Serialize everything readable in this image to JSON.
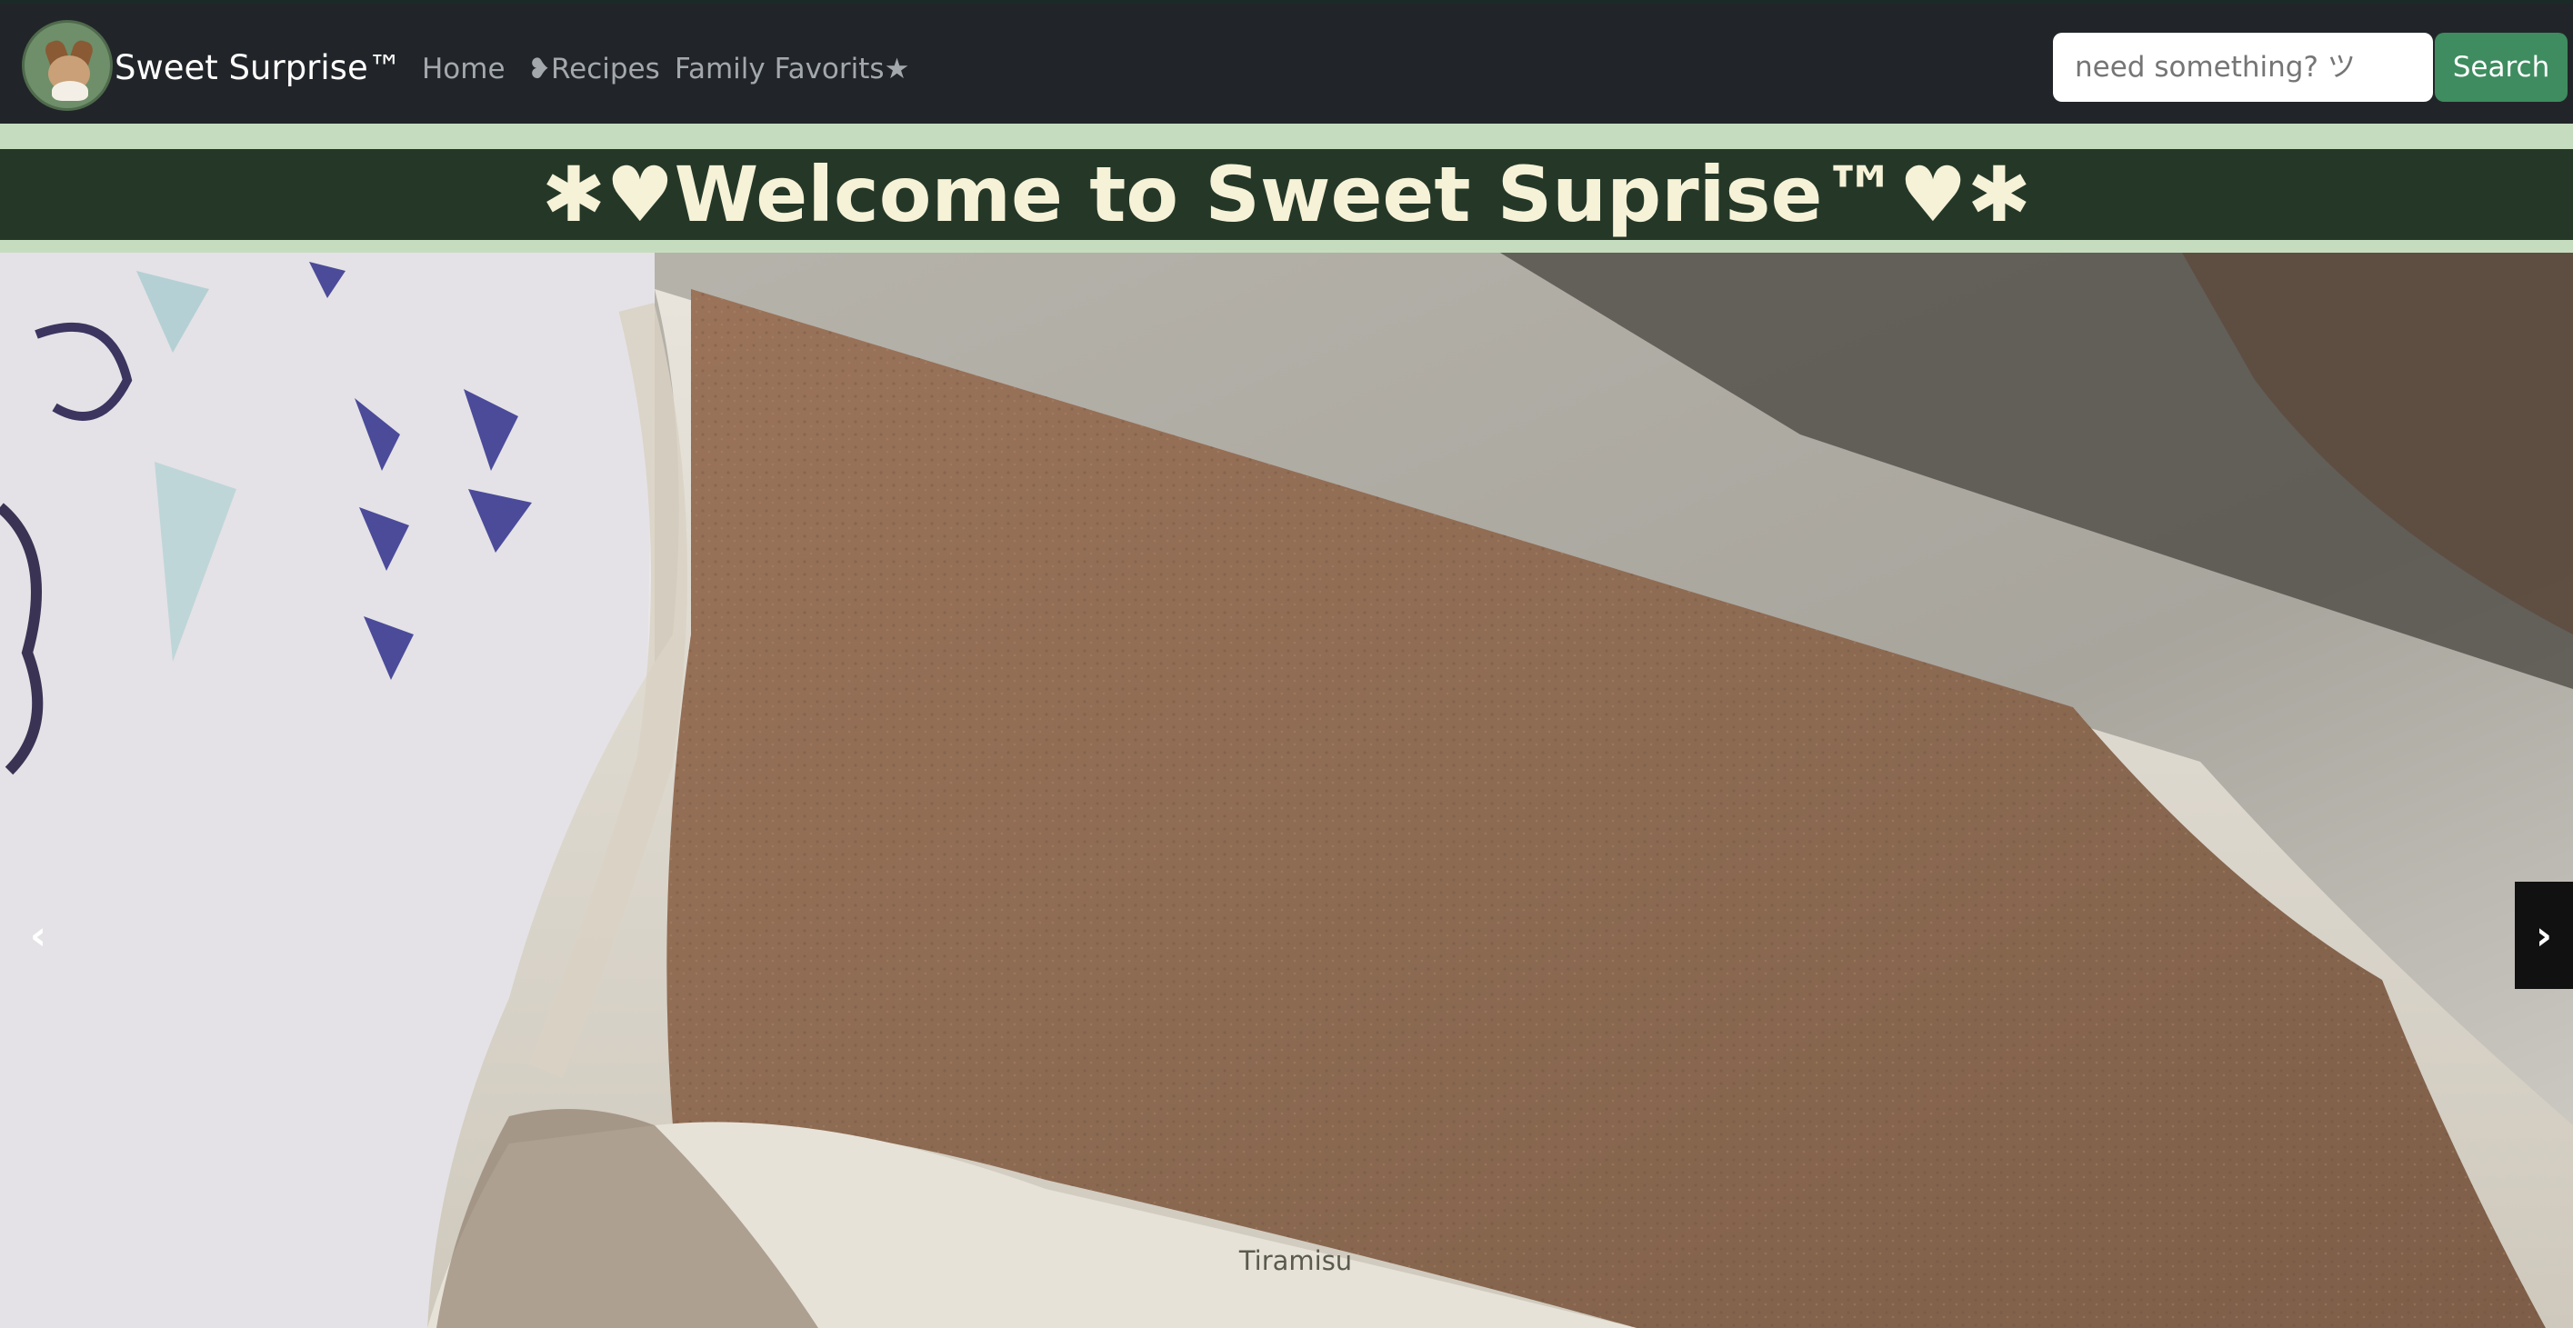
{
  "navbar": {
    "brand": "Sweet Surprise™",
    "links": [
      "Home",
      "❥Recipes",
      "Family Favorits★"
    ],
    "search": {
      "placeholder": "need something? ツ",
      "button": "Search"
    }
  },
  "hero": {
    "title": "✱♥Welcome to Sweet Suprise™♥✱"
  },
  "carousel": {
    "prev": "‹",
    "next": "›",
    "caption": "Tiramisu"
  }
}
